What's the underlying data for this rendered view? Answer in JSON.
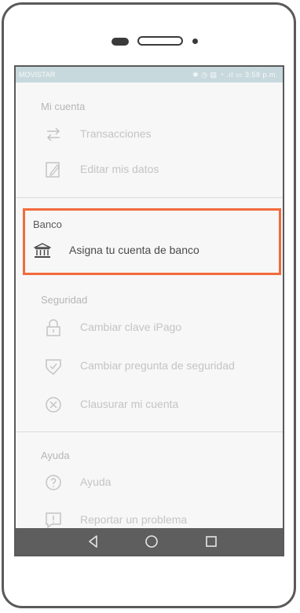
{
  "device": {
    "frame_color": "#5a5a5a",
    "accent_color": "#f26a3c"
  },
  "statusbar": {
    "carrier": "MOVISTAR",
    "time": "3:58 p.m."
  },
  "menu": {
    "mi_cuenta": {
      "header": "Mi cuenta",
      "items": [
        {
          "label": "Transacciones",
          "icon": "transfer-arrows-icon"
        },
        {
          "label": "Editar mis datos",
          "icon": "edit-icon"
        }
      ]
    },
    "banco": {
      "header": "Banco",
      "items": [
        {
          "label": "Asigna tu cuenta de banco",
          "icon": "bank-icon"
        }
      ]
    },
    "seguridad": {
      "header": "Seguridad",
      "items": [
        {
          "label": "Cambiar clave iPago",
          "icon": "lock-icon"
        },
        {
          "label": "Cambiar pregunta de seguridad",
          "icon": "shield-check-icon"
        },
        {
          "label": "Clausurar mi cuenta",
          "icon": "close-circle-icon"
        }
      ]
    },
    "ayuda": {
      "header": "Ayuda",
      "items": [
        {
          "label": "Ayuda",
          "icon": "help-circle-icon"
        },
        {
          "label": "Reportar un problema",
          "icon": "report-icon"
        }
      ]
    }
  },
  "navbar": {
    "buttons": [
      "back-icon",
      "home-icon",
      "recents-icon"
    ]
  }
}
